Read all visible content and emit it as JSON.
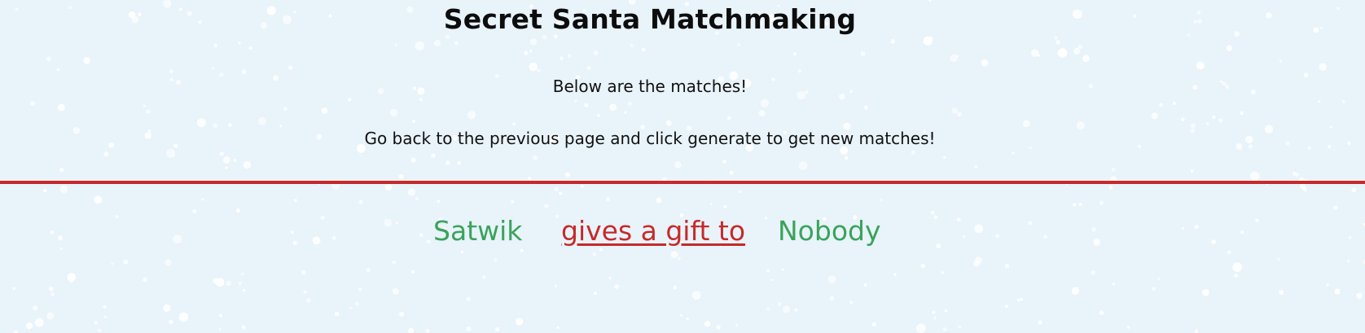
{
  "page": {
    "title": "Secret Santa Matchmaking",
    "subtitle": "Below are the matches!",
    "instruction": "Go back to the previous page and click generate to get new matches!"
  },
  "matches": [
    {
      "giver": "Satwik",
      "link_text": "gives a gift to",
      "receiver": "Nobody"
    }
  ],
  "colors": {
    "background": "#e8f3fa",
    "divider": "#c62a2a",
    "name": "#3aa35a",
    "link": "#c62a2a"
  }
}
